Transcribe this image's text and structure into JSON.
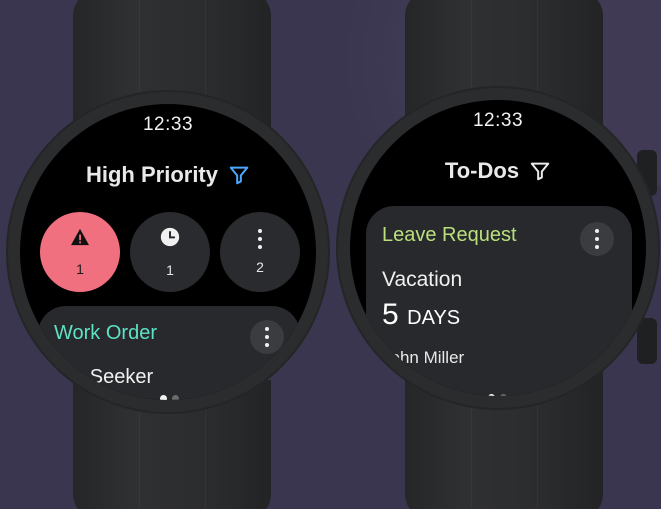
{
  "colors": {
    "background": "#3b3650",
    "high_alert": "#f07080",
    "filter_active": "#4aa8ff",
    "work_order_title": "#5de2c5",
    "leave_request_title": "#b9e07d"
  },
  "left_watch": {
    "time": "12:33",
    "title": "High Priority",
    "filter_icon": "filter-icon",
    "chips": [
      {
        "icon": "warning-icon",
        "count": "1"
      },
      {
        "icon": "clock-icon",
        "count": "1"
      },
      {
        "icon": "more-vertical-icon",
        "count": "2"
      }
    ],
    "card": {
      "title": "Work Order",
      "menu_icon": "more-vertical-icon",
      "line1": "Job Seeker"
    },
    "pager": {
      "active_index": 0,
      "total": 2
    }
  },
  "right_watch": {
    "time": "12:33",
    "title": "To-Dos",
    "filter_icon": "filter-icon",
    "card": {
      "title": "Leave Request",
      "menu_icon": "more-vertical-icon",
      "type": "Vacation",
      "amount": "5",
      "unit": "DAYS",
      "employee": "John Miller"
    },
    "pager": {
      "active_index": 0,
      "total": 2
    }
  }
}
